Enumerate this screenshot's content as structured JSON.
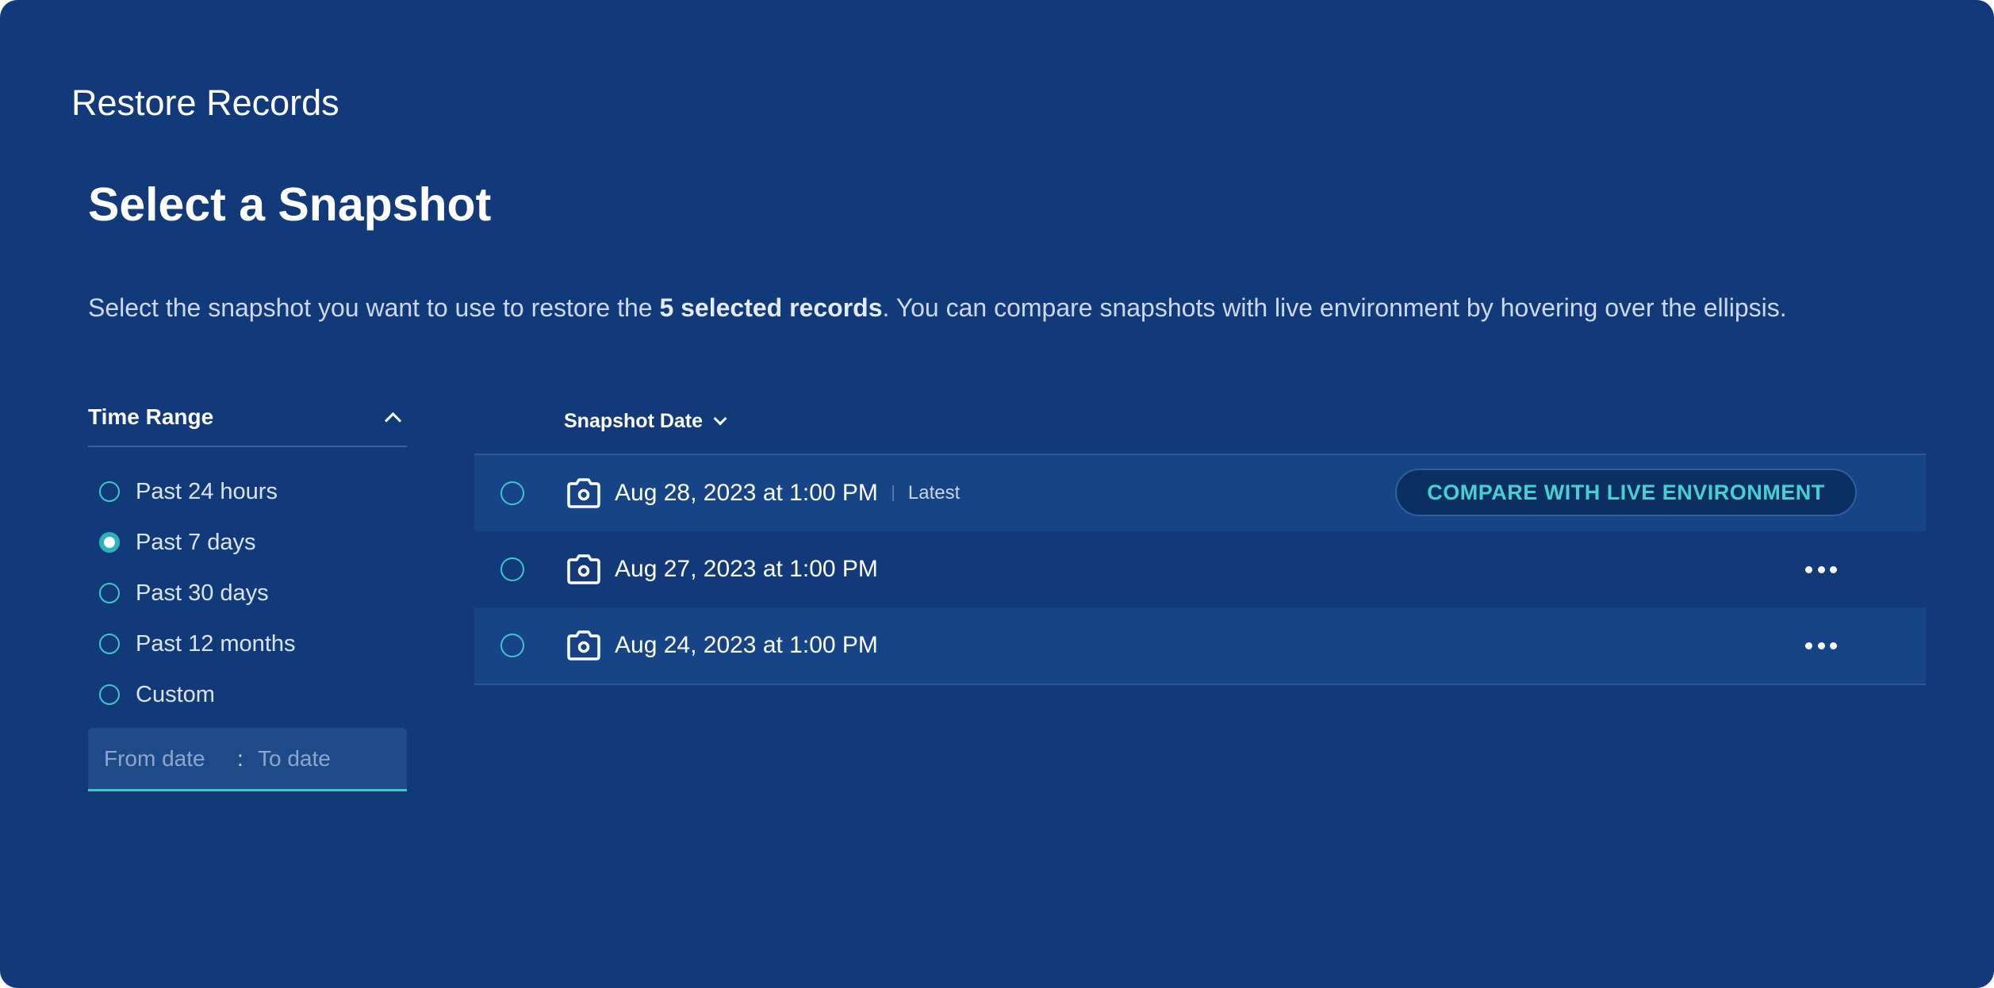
{
  "window": {
    "title": "Restore Records"
  },
  "page": {
    "heading": "Select a Snapshot",
    "description": {
      "before": "Select the snapshot you want to use to restore the ",
      "emphasis": "5 selected records",
      "after": ". You can compare snapshots with live environment by hovering over the ellipsis."
    }
  },
  "filter": {
    "title": "Time Range",
    "options": [
      {
        "label": "Past 24 hours",
        "selected": false
      },
      {
        "label": "Past 7 days",
        "selected": true
      },
      {
        "label": "Past 30 days",
        "selected": false
      },
      {
        "label": "Past 12 months",
        "selected": false
      },
      {
        "label": "Custom",
        "selected": false
      }
    ],
    "date_range": {
      "from_placeholder": "From date",
      "separator": ":",
      "to_placeholder": "To date"
    }
  },
  "table": {
    "sort_label": "Snapshot Date",
    "rows": [
      {
        "date": "Aug 28, 2023 at 1:00 PM",
        "tag": "Latest",
        "action": "COMPARE WITH LIVE ENVIRONMENT",
        "icon": "camera-icon"
      },
      {
        "date": "Aug 27, 2023 at 1:00 PM",
        "tag": "",
        "action": "",
        "icon": "camera-icon"
      },
      {
        "date": "Aug 24, 2023 at 1:00 PM",
        "tag": "",
        "action": "",
        "icon": "camera-icon"
      }
    ]
  },
  "colors": {
    "background": "#12397a",
    "row_highlight": "#164487",
    "accent": "#3fc7c9",
    "button_text": "#49cfd1"
  }
}
